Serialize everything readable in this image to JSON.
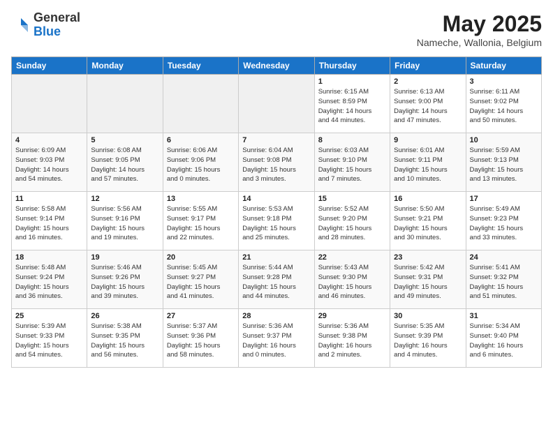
{
  "header": {
    "logo_general": "General",
    "logo_blue": "Blue",
    "title": "May 2025",
    "subtitle": "Nameche, Wallonia, Belgium"
  },
  "weekdays": [
    "Sunday",
    "Monday",
    "Tuesday",
    "Wednesday",
    "Thursday",
    "Friday",
    "Saturday"
  ],
  "weeks": [
    [
      {
        "day": "",
        "info": ""
      },
      {
        "day": "",
        "info": ""
      },
      {
        "day": "",
        "info": ""
      },
      {
        "day": "",
        "info": ""
      },
      {
        "day": "1",
        "info": "Sunrise: 6:15 AM\nSunset: 8:59 PM\nDaylight: 14 hours\nand 44 minutes."
      },
      {
        "day": "2",
        "info": "Sunrise: 6:13 AM\nSunset: 9:00 PM\nDaylight: 14 hours\nand 47 minutes."
      },
      {
        "day": "3",
        "info": "Sunrise: 6:11 AM\nSunset: 9:02 PM\nDaylight: 14 hours\nand 50 minutes."
      }
    ],
    [
      {
        "day": "4",
        "info": "Sunrise: 6:09 AM\nSunset: 9:03 PM\nDaylight: 14 hours\nand 54 minutes."
      },
      {
        "day": "5",
        "info": "Sunrise: 6:08 AM\nSunset: 9:05 PM\nDaylight: 14 hours\nand 57 minutes."
      },
      {
        "day": "6",
        "info": "Sunrise: 6:06 AM\nSunset: 9:06 PM\nDaylight: 15 hours\nand 0 minutes."
      },
      {
        "day": "7",
        "info": "Sunrise: 6:04 AM\nSunset: 9:08 PM\nDaylight: 15 hours\nand 3 minutes."
      },
      {
        "day": "8",
        "info": "Sunrise: 6:03 AM\nSunset: 9:10 PM\nDaylight: 15 hours\nand 7 minutes."
      },
      {
        "day": "9",
        "info": "Sunrise: 6:01 AM\nSunset: 9:11 PM\nDaylight: 15 hours\nand 10 minutes."
      },
      {
        "day": "10",
        "info": "Sunrise: 5:59 AM\nSunset: 9:13 PM\nDaylight: 15 hours\nand 13 minutes."
      }
    ],
    [
      {
        "day": "11",
        "info": "Sunrise: 5:58 AM\nSunset: 9:14 PM\nDaylight: 15 hours\nand 16 minutes."
      },
      {
        "day": "12",
        "info": "Sunrise: 5:56 AM\nSunset: 9:16 PM\nDaylight: 15 hours\nand 19 minutes."
      },
      {
        "day": "13",
        "info": "Sunrise: 5:55 AM\nSunset: 9:17 PM\nDaylight: 15 hours\nand 22 minutes."
      },
      {
        "day": "14",
        "info": "Sunrise: 5:53 AM\nSunset: 9:18 PM\nDaylight: 15 hours\nand 25 minutes."
      },
      {
        "day": "15",
        "info": "Sunrise: 5:52 AM\nSunset: 9:20 PM\nDaylight: 15 hours\nand 28 minutes."
      },
      {
        "day": "16",
        "info": "Sunrise: 5:50 AM\nSunset: 9:21 PM\nDaylight: 15 hours\nand 30 minutes."
      },
      {
        "day": "17",
        "info": "Sunrise: 5:49 AM\nSunset: 9:23 PM\nDaylight: 15 hours\nand 33 minutes."
      }
    ],
    [
      {
        "day": "18",
        "info": "Sunrise: 5:48 AM\nSunset: 9:24 PM\nDaylight: 15 hours\nand 36 minutes."
      },
      {
        "day": "19",
        "info": "Sunrise: 5:46 AM\nSunset: 9:26 PM\nDaylight: 15 hours\nand 39 minutes."
      },
      {
        "day": "20",
        "info": "Sunrise: 5:45 AM\nSunset: 9:27 PM\nDaylight: 15 hours\nand 41 minutes."
      },
      {
        "day": "21",
        "info": "Sunrise: 5:44 AM\nSunset: 9:28 PM\nDaylight: 15 hours\nand 44 minutes."
      },
      {
        "day": "22",
        "info": "Sunrise: 5:43 AM\nSunset: 9:30 PM\nDaylight: 15 hours\nand 46 minutes."
      },
      {
        "day": "23",
        "info": "Sunrise: 5:42 AM\nSunset: 9:31 PM\nDaylight: 15 hours\nand 49 minutes."
      },
      {
        "day": "24",
        "info": "Sunrise: 5:41 AM\nSunset: 9:32 PM\nDaylight: 15 hours\nand 51 minutes."
      }
    ],
    [
      {
        "day": "25",
        "info": "Sunrise: 5:39 AM\nSunset: 9:33 PM\nDaylight: 15 hours\nand 54 minutes."
      },
      {
        "day": "26",
        "info": "Sunrise: 5:38 AM\nSunset: 9:35 PM\nDaylight: 15 hours\nand 56 minutes."
      },
      {
        "day": "27",
        "info": "Sunrise: 5:37 AM\nSunset: 9:36 PM\nDaylight: 15 hours\nand 58 minutes."
      },
      {
        "day": "28",
        "info": "Sunrise: 5:36 AM\nSunset: 9:37 PM\nDaylight: 16 hours\nand 0 minutes."
      },
      {
        "day": "29",
        "info": "Sunrise: 5:36 AM\nSunset: 9:38 PM\nDaylight: 16 hours\nand 2 minutes."
      },
      {
        "day": "30",
        "info": "Sunrise: 5:35 AM\nSunset: 9:39 PM\nDaylight: 16 hours\nand 4 minutes."
      },
      {
        "day": "31",
        "info": "Sunrise: 5:34 AM\nSunset: 9:40 PM\nDaylight: 16 hours\nand 6 minutes."
      }
    ]
  ]
}
